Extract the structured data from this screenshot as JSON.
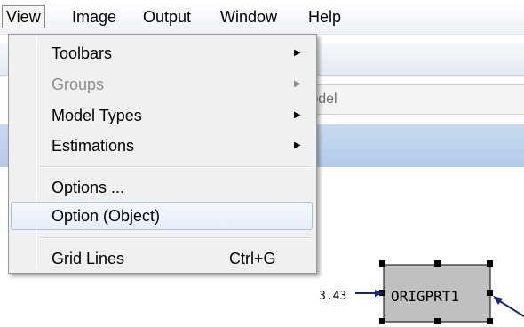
{
  "menubar": {
    "items": [
      "View",
      "Image",
      "Output",
      "Window",
      "Help"
    ]
  },
  "background": {
    "model_label": "Model"
  },
  "view_menu": {
    "items": [
      {
        "label": "Toolbars",
        "submenu": true,
        "disabled": false
      },
      {
        "label": "Groups",
        "submenu": true,
        "disabled": true
      },
      {
        "label": "Model Types",
        "submenu": true,
        "disabled": false
      },
      {
        "label": "Estimations",
        "submenu": true,
        "disabled": false
      },
      {
        "label": "Options ...",
        "submenu": false,
        "disabled": false
      },
      {
        "label": "Option (Object)",
        "submenu": false,
        "disabled": false,
        "highlighted": true
      },
      {
        "label": "Grid Lines",
        "shortcut": "Ctrl+G",
        "submenu": false,
        "disabled": false
      }
    ],
    "arrow_glyph": "▶"
  },
  "diagram": {
    "node_label": "ORIGPRT1",
    "path_value": "3.43",
    "colors": {
      "node_fill": "#c0c0c0",
      "arrow": "#1a237e",
      "handle": "#000000"
    }
  }
}
